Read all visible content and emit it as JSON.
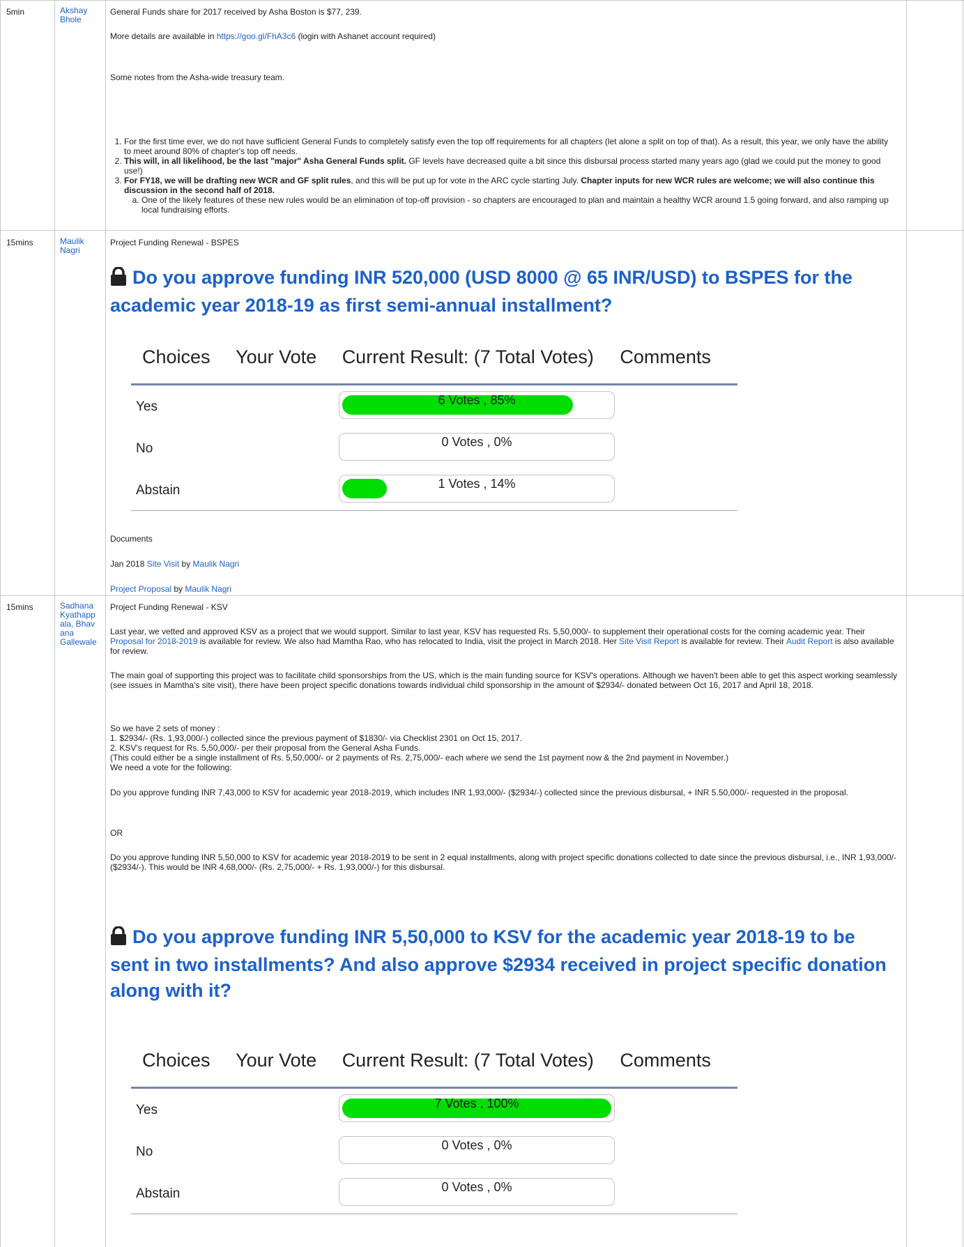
{
  "rows": [
    {
      "time": "5min",
      "owner": [
        "Akshay",
        "Bhole"
      ],
      "gf_line": "General Funds share for 2017 received by Asha Boston is $77, 239.",
      "more_prefix": "More details are available in ",
      "more_link": "https://goo.gl/FhA3c6",
      "more_suffix": " (login with Ashanet account required)",
      "notes_intro": "Some notes from the Asha-wide treasury team.",
      "item1": "For the first time ever, we do not have sufficient General Funds to completely satisfy even the top off requirements for all chapters (let alone a split on top of that). As a result, this year, we only have the ability to meet around 80% of chapter's top off needs.",
      "item2_bold": "This will, in all likelihood, be the last \"major\" Asha General Funds split.",
      "item2_rest": " GF levels have decreased quite a bit since this disbursal process started many years ago (glad we could put the money to good use!)",
      "item3_bold1": "For FY18, we will be drafting new WCR and GF split rules",
      "item3_mid": ", and this will be put up for vote in the ARC cycle starting July. ",
      "item3_bold2": "Chapter inputs for new WCR rules are welcome; we will also continue this discussion in the second half of 2018.",
      "item3a": "One of the likely features of these new rules would be an elimination of top-off provision - so chapters are encouraged to plan and maintain a healthy WCR around 1.5 going forward, and also ramping up local fundraising efforts."
    },
    {
      "time": "15mins",
      "owner": [
        "Maulik",
        "Nagri"
      ],
      "title": "Project Funding Renewal - BSPES",
      "question": "Do you approve funding INR 520,000 (USD 8000 @ 65 INR/USD) to BSPES for the academic year 2018-19 as first semi-annual installment?",
      "docs_label": "Documents",
      "doc1_prefix": "Jan 2018 ",
      "doc1_link": "Site Visit",
      "doc1_by": " by ",
      "doc1_author": "Maulik Nagri",
      "doc2_link": "Project Proposal",
      "doc2_by": " by ",
      "doc2_author": "Maulik Nagri"
    },
    {
      "time": "15mins",
      "owner": [
        "Sadhana",
        "Kyathapp",
        "ala",
        ", Bhav",
        "ana",
        "Gallewale"
      ],
      "title": "Project Funding Renewal - KSV",
      "p1_a": "Last year, we vetted and approved KSV as a project that we would support.  Similar to last year, KSV has requested Rs. 5,50,000/- to supplement their operational costs for the coming academic year. Their ",
      "p1_link1": "Proposal for 2018-2019",
      "p1_b": " is available for review.  We also had Mamtha Rao, who has relocated to India, visit the project in March 2018. Her ",
      "p1_link2": "Site Visit Report",
      "p1_c": " is available for review.  Their ",
      "p1_link3": "Audit Report",
      "p1_d": " is also available for review.",
      "p2": "The main goal of supporting this project was to facilitate child sponsorships from the US, which is the main funding source for KSV's operations. Although we haven't been able to get this aspect working seamlessly (see issues in Mamtha's site visit), there have been project specific donations towards individual child sponsorship in the amount of $2934/-  donated between Oct 16, 2017 and April 18, 2018.",
      "p3_l1": "So we have 2 sets of money :",
      "p3_l2": "1. $2934/- (Rs. 1,93,000/-) collected since the previous payment of $1830/- via Checklist 2301 on Oct 15, 2017.",
      "p3_l3": "2.  KSV's request for Rs. 5,50,000/- per their proposal from the General Asha Funds.",
      "p3_l4": "(This could either be a single installment of Rs. 5,50,000/- or 2 payments of Rs. 2,75,000/- each where we send the 1st payment now & the 2nd payment in November.)",
      "p3_l5": "We need a vote for the following:",
      "p4": "Do you approve funding INR 7,43,000 to KSV for academic year 2018-2019, which includes INR 1,93,000/- ($2934/-) collected since the previous disbursal, + INR 5.50,000/- requested in the proposal.",
      "or": "OR",
      "p5": "Do you approve funding INR 5,50,000 to KSV for academic year 2018-2019 to be sent in 2 equal installments, along with project specific donations collected to date since the previous disbursal, i.e., INR 1,93,000/- ($2934/-). This would be INR 4,68,000/- (Rs. 2,75,000/- + Rs. 1,93,000/-) for this disbursal.",
      "question": "Do you approve funding INR 5,50,000 to KSV for the academic year 2018-19 to be sent in two installments? And also approve $2934 received in project specific donation along with it?"
    }
  ],
  "poll_header": {
    "choices": "Choices",
    "your_vote": "Your Vote",
    "current_result": "Current Result: (7 Total Votes)",
    "comments": "Comments"
  },
  "polls": [
    {
      "options": [
        {
          "label": "Yes",
          "result": "6 Votes , 85%",
          "fraction": 0.857
        },
        {
          "label": "No",
          "result": "0 Votes , 0%",
          "fraction": 0
        },
        {
          "label": "Abstain",
          "result": "1 Votes , 14%",
          "fraction": 0.143
        }
      ]
    },
    {
      "options": [
        {
          "label": "Yes",
          "result": "7 Votes , 100%",
          "fraction": 1.0
        },
        {
          "label": "No",
          "result": "0 Votes , 0%",
          "fraction": 0
        },
        {
          "label": "Abstain",
          "result": "0 Votes , 0%",
          "fraction": 0
        }
      ]
    }
  ],
  "colors": {
    "link": "#1c61c9",
    "bar_fill": "#00dd00",
    "border": "#c8c8c8",
    "separator": "#7485a8"
  }
}
